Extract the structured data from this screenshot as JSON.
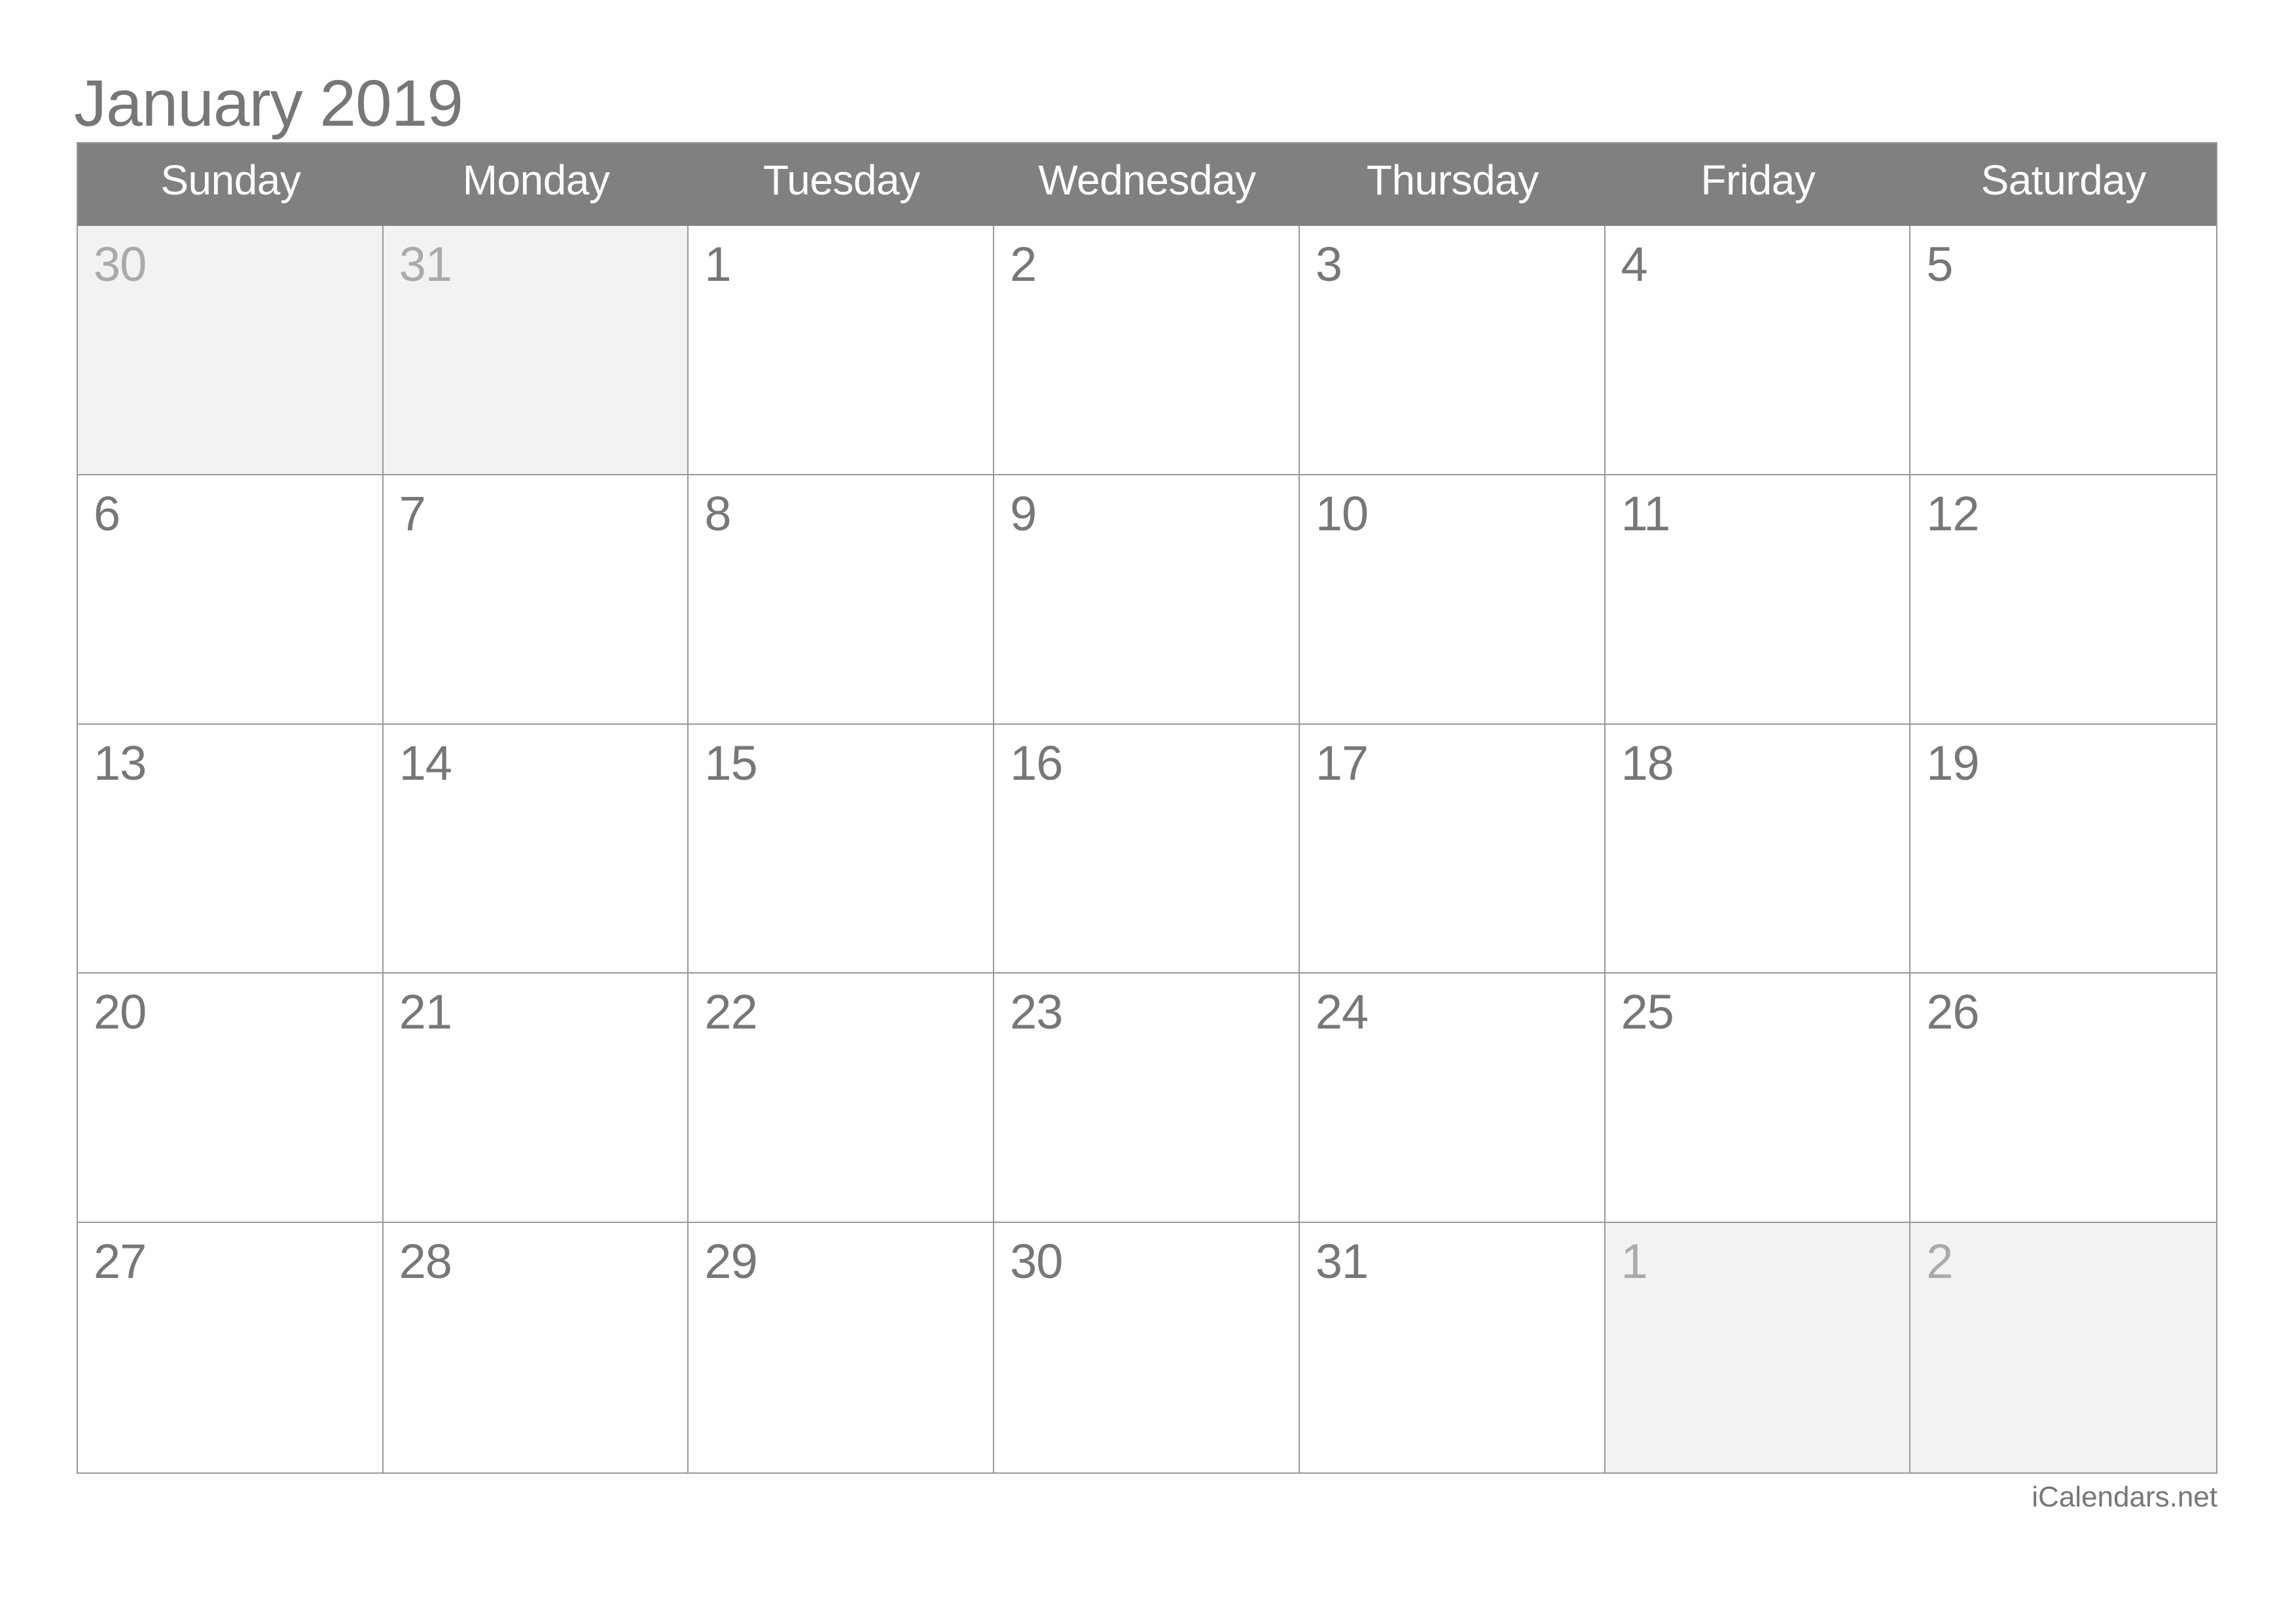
{
  "title": "January 2019",
  "weekdays": [
    "Sunday",
    "Monday",
    "Tuesday",
    "Wednesday",
    "Thursday",
    "Friday",
    "Saturday"
  ],
  "weeks": [
    [
      {
        "day": "30",
        "other": true
      },
      {
        "day": "31",
        "other": true
      },
      {
        "day": "1"
      },
      {
        "day": "2"
      },
      {
        "day": "3"
      },
      {
        "day": "4"
      },
      {
        "day": "5"
      }
    ],
    [
      {
        "day": "6"
      },
      {
        "day": "7"
      },
      {
        "day": "8"
      },
      {
        "day": "9"
      },
      {
        "day": "10"
      },
      {
        "day": "11"
      },
      {
        "day": "12"
      }
    ],
    [
      {
        "day": "13"
      },
      {
        "day": "14"
      },
      {
        "day": "15"
      },
      {
        "day": "16"
      },
      {
        "day": "17"
      },
      {
        "day": "18"
      },
      {
        "day": "19"
      }
    ],
    [
      {
        "day": "20"
      },
      {
        "day": "21"
      },
      {
        "day": "22"
      },
      {
        "day": "23"
      },
      {
        "day": "24"
      },
      {
        "day": "25"
      },
      {
        "day": "26"
      }
    ],
    [
      {
        "day": "27"
      },
      {
        "day": "28"
      },
      {
        "day": "29"
      },
      {
        "day": "30"
      },
      {
        "day": "31"
      },
      {
        "day": "1",
        "other": true
      },
      {
        "day": "2",
        "other": true
      }
    ]
  ],
  "footer": "iCalendars.net",
  "colors": {
    "header_bg": "#808080",
    "header_text": "#ffffff",
    "day_text": "#777777",
    "other_month_text": "#aaaaaa",
    "other_month_bg": "#f2f2f2",
    "grid_line": "#999999"
  }
}
